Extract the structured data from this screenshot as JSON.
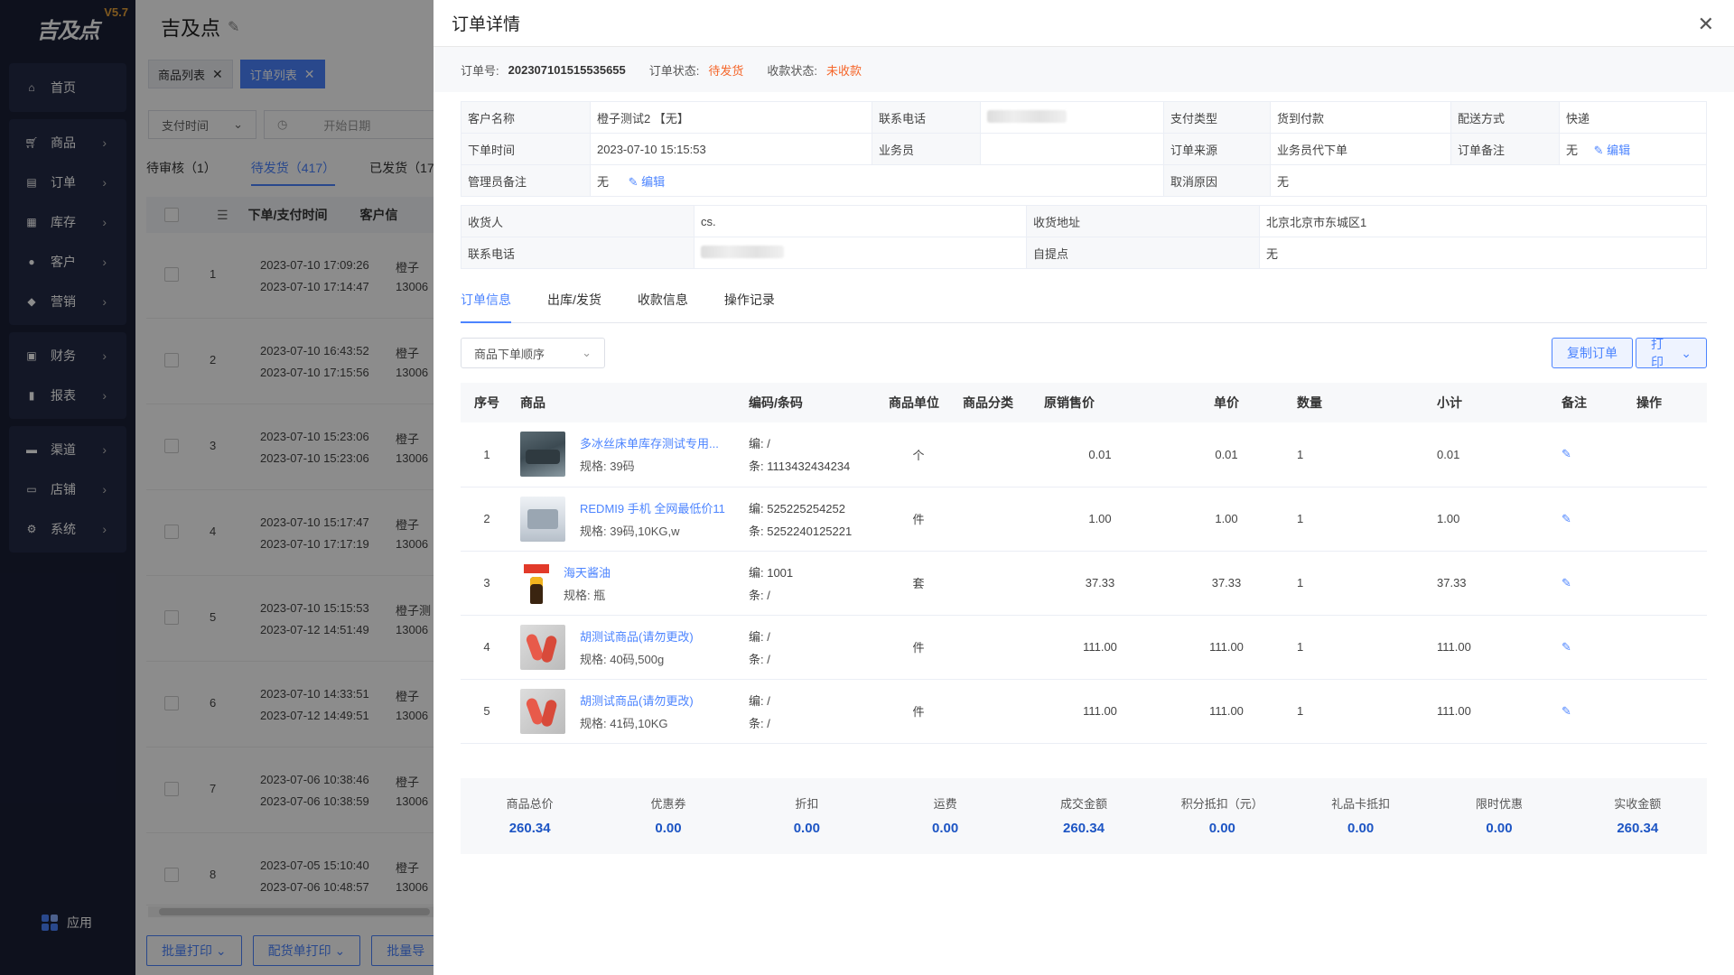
{
  "brand": {
    "logo": "吉及点",
    "version": "V5.7"
  },
  "sidebar": {
    "groups": [
      {
        "items": [
          {
            "label": "首页",
            "icon": "home-icon"
          }
        ]
      },
      {
        "items": [
          {
            "label": "商品",
            "icon": "cart-icon"
          },
          {
            "label": "订单",
            "icon": "order-icon"
          },
          {
            "label": "库存",
            "icon": "grid-icon"
          },
          {
            "label": "客户",
            "icon": "user-icon"
          },
          {
            "label": "营销",
            "icon": "tag-icon"
          }
        ]
      },
      {
        "items": [
          {
            "label": "财务",
            "icon": "finance-icon"
          },
          {
            "label": "报表",
            "icon": "chart-icon"
          }
        ]
      },
      {
        "items": [
          {
            "label": "渠道",
            "icon": "channel-icon"
          },
          {
            "label": "店铺",
            "icon": "store-icon"
          },
          {
            "label": "系统",
            "icon": "gear-icon"
          }
        ]
      }
    ],
    "apps_label": "应用"
  },
  "main": {
    "title": "吉及点",
    "tabs": [
      {
        "label": "商品列表"
      },
      {
        "label": "订单列表"
      }
    ],
    "filter_select": "支付时间",
    "date_placeholder": "开始日期",
    "status_tabs": [
      "待审核（1）",
      "待发货（417）",
      "已发货（17"
    ],
    "columns": [
      "下单/支付时间",
      "客户信"
    ],
    "rows": [
      {
        "no": "1",
        "t1": "2023-07-10 17:09:26",
        "t2": "2023-07-10 17:14:47",
        "c1": "橙子",
        "c2": "13006"
      },
      {
        "no": "2",
        "t1": "2023-07-10 16:43:52",
        "t2": "2023-07-10 17:15:56",
        "c1": "橙子",
        "c2": "13006"
      },
      {
        "no": "3",
        "t1": "2023-07-10 15:23:06",
        "t2": "2023-07-10 15:23:06",
        "c1": "橙子",
        "c2": "13006"
      },
      {
        "no": "4",
        "t1": "2023-07-10 15:17:47",
        "t2": "2023-07-10 17:17:19",
        "c1": "橙子",
        "c2": "13006"
      },
      {
        "no": "5",
        "t1": "2023-07-10 15:15:53",
        "t2": "2023-07-12 14:51:49",
        "c1": "橙子测",
        "c2": "13006"
      },
      {
        "no": "6",
        "t1": "2023-07-10 14:33:51",
        "t2": "2023-07-12 14:49:51",
        "c1": "橙子",
        "c2": "13006"
      },
      {
        "no": "7",
        "t1": "2023-07-06 10:38:46",
        "t2": "2023-07-06 10:38:59",
        "c1": "橙子",
        "c2": "13006"
      },
      {
        "no": "8",
        "t1": "2023-07-05 15:10:40",
        "t2": "2023-07-06 10:48:57",
        "c1": "橙子",
        "c2": "13006"
      }
    ],
    "bottom_buttons": [
      "批量打印",
      "配货单打印",
      "批量导"
    ]
  },
  "drawer": {
    "title": "订单详情",
    "info": {
      "order_no_label": "订单号:",
      "order_no": "202307101515535655",
      "status_label": "订单状态:",
      "status": "待发货",
      "pay_label": "收款状态:",
      "pay": "未收款"
    },
    "kv1": {
      "customer_label": "客户名称",
      "customer": "橙子测试2 【无】",
      "phone_label": "联系电话",
      "paytype_label": "支付类型",
      "paytype": "货到付款",
      "delivery_label": "配送方式",
      "delivery": "快递",
      "time_label": "下单时间",
      "time": "2023-07-10 15:15:53",
      "sales_label": "业务员",
      "sales": "",
      "source_label": "订单来源",
      "source": "业务员代下单",
      "remark_label": "订单备注",
      "remark": "无",
      "edit": "编辑",
      "admin_label": "管理员备注",
      "admin": "无",
      "cancel_label": "取消原因",
      "cancel": "无"
    },
    "kv2": {
      "receiver_label": "收货人",
      "receiver": "cs.",
      "addr_label": "收货地址",
      "addr": "北京北京市东城区1",
      "phone_label": "联系电话",
      "pickup_label": "自提点",
      "pickup": "无"
    },
    "tabs": [
      "订单信息",
      "出库/发货",
      "收款信息",
      "操作记录"
    ],
    "sort_select": "商品下单顺序",
    "copy_button": "复制订单",
    "print_button": "打印",
    "columns": [
      "序号",
      "商品",
      "编码/条码",
      "商品单位",
      "商品分类",
      "原销售价",
      "单价",
      "数量",
      "小计",
      "备注",
      "操作"
    ],
    "items": [
      {
        "no": "1",
        "name": "多冰丝床单库存测试专用...",
        "spec": "规格:   39码",
        "code": "编:  /",
        "barcode": "条:  1113432434234",
        "unit": "个",
        "category": "",
        "orig": "0.01",
        "price": "0.01",
        "qty": "1",
        "subtotal": "0.01",
        "thumb": "sofa"
      },
      {
        "no": "2",
        "name": "REDMI9 手机 全网最低价11",
        "spec": "规格:   39码,10KG,w",
        "code": "编:  525225254252",
        "barcode": "条:  5252240125221",
        "unit": "件",
        "category": "",
        "orig": "1.00",
        "price": "1.00",
        "qty": "1",
        "subtotal": "1.00",
        "thumb": "sheet"
      },
      {
        "no": "3",
        "name": "海天酱油",
        "spec": "规格:   瓶",
        "code": "编:  1001",
        "barcode": "条:  /",
        "unit": "套",
        "category": "",
        "orig": "37.33",
        "price": "37.33",
        "qty": "1",
        "subtotal": "37.33",
        "thumb": "sauce"
      },
      {
        "no": "4",
        "name": "胡测试商品(请勿更改)",
        "spec": "规格:   40码,500g",
        "code": "编:  /",
        "barcode": "条:  /",
        "unit": "件",
        "category": "",
        "orig": "111.00",
        "price": "111.00",
        "qty": "1",
        "subtotal": "111.00",
        "thumb": "feet"
      },
      {
        "no": "5",
        "name": "胡测试商品(请勿更改)",
        "spec": "规格:   41码,10KG",
        "code": "编:  /",
        "barcode": "条:  /",
        "unit": "件",
        "category": "",
        "orig": "111.00",
        "price": "111.00",
        "qty": "1",
        "subtotal": "111.00",
        "thumb": "feet"
      }
    ],
    "summary": [
      {
        "label": "商品总价",
        "value": "260.34"
      },
      {
        "label": "优惠券",
        "value": "0.00"
      },
      {
        "label": "折扣",
        "value": "0.00"
      },
      {
        "label": "运费",
        "value": "0.00"
      },
      {
        "label": "成交金额",
        "value": "260.34"
      },
      {
        "label": "积分抵扣（元）",
        "value": "0.00"
      },
      {
        "label": "礼品卡抵扣",
        "value": "0.00"
      },
      {
        "label": "限时优惠",
        "value": "0.00"
      },
      {
        "label": "实收金额",
        "value": "260.34"
      }
    ]
  },
  "colors": {
    "accent": "#4c84ff",
    "warning": "#f5662a",
    "sidebar": "#1a1f36",
    "amount": "#1d55c4"
  }
}
